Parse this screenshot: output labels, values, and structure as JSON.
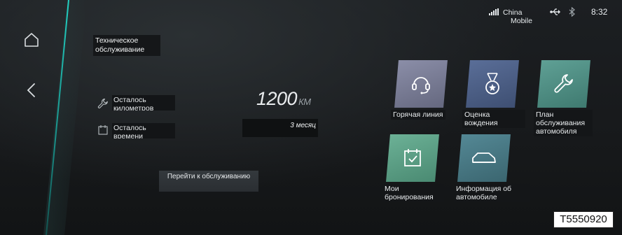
{
  "status_bar": {
    "carrier_line1": "China",
    "carrier_line2": "Mobile",
    "time": "8:32",
    "signal_icon": "signal-bars-icon",
    "usb_icon": "usb-icon",
    "bluetooth_icon": "bluetooth-icon"
  },
  "nav": {
    "home_icon": "home-icon",
    "back_icon": "back-arrow-icon"
  },
  "page": {
    "title": "Техническое обслуживание",
    "km_row_label": "Осталось километров",
    "time_row_label": "Осталось времени",
    "km_value": "1200",
    "km_unit": "КМ",
    "months_value": "3 месяц",
    "service_button": "Перейти к обслуживанию"
  },
  "tiles": {
    "hotline": "Горячая линия",
    "driving_score": "Оценка вождения",
    "maintenance_plan": "План обслуживания автомобиля",
    "my_bookings": "Мои бронирования",
    "vehicle_info": "Информация об автомобиле"
  },
  "colors": {
    "accent_line": "#1fb3a8",
    "tile_purple": "#7a7d97",
    "tile_blue": "#4a5d86",
    "tile_teal": "#4f8f84",
    "tile_green": "#5d9f86",
    "tile_steel": "#4d7b86"
  },
  "figure_tag": "T5550920"
}
